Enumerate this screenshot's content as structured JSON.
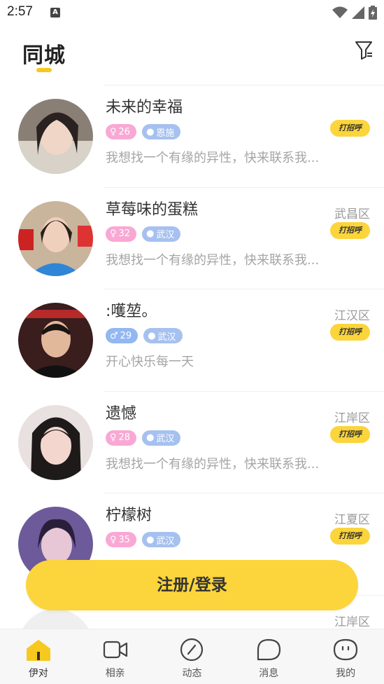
{
  "status_bar": {
    "time": "2:57",
    "a_badge": "A"
  },
  "header": {
    "title": "同城",
    "filter_icon": "filter-icon"
  },
  "users": [
    {
      "name": "未来的幸福",
      "district": "",
      "gender": "female",
      "age": "26",
      "location": "恩施",
      "bio": "我想找一个有缘的异性，快来联系我...",
      "greet_label": "打招呼"
    },
    {
      "name": "草莓味的蛋糕",
      "district": "武昌区",
      "gender": "female",
      "age": "32",
      "location": "武汉",
      "bio": "我想找一个有缘的异性，快来联系我...",
      "greet_label": "打招呼"
    },
    {
      "name": ":嚄堃。",
      "district": "江汉区",
      "gender": "male",
      "age": "29",
      "location": "武汉",
      "bio": "开心快乐每一天",
      "greet_label": "打招呼"
    },
    {
      "name": "遗憾",
      "district": "江岸区",
      "gender": "female",
      "age": "28",
      "location": "武汉",
      "bio": "我想找一个有缘的异性，快来联系我...",
      "greet_label": "打招呼"
    },
    {
      "name": "柠檬树",
      "district": "江夏区",
      "gender": "female",
      "age": "35",
      "location": "武汉",
      "bio": "",
      "greet_label": "打招呼"
    },
    {
      "name": "",
      "district": "江岸区",
      "gender": "",
      "age": "",
      "location": "",
      "bio": "",
      "greet_label": ""
    }
  ],
  "cta": {
    "label": "注册/登录"
  },
  "tabbar": [
    {
      "label": "伊对",
      "icon": "home-icon",
      "active": true
    },
    {
      "label": "相亲",
      "icon": "video-icon",
      "active": false
    },
    {
      "label": "动态",
      "icon": "compass-icon",
      "active": false
    },
    {
      "label": "消息",
      "icon": "message-icon",
      "active": false
    },
    {
      "label": "我的",
      "icon": "profile-icon",
      "active": false
    }
  ],
  "colors": {
    "accent": "#fbd53b",
    "female_tag": "#f9a8d4",
    "male_tag": "#93b7f1",
    "location_tag": "#a6c1f0"
  }
}
